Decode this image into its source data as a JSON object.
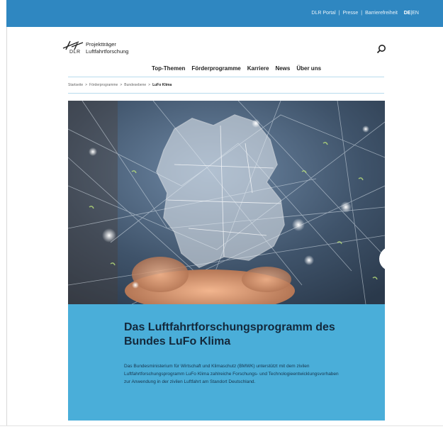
{
  "topbar": {
    "links": [
      "DLR Portal",
      "Presse",
      "Barrierefreiheit"
    ],
    "separator": "|",
    "lang_active": "DE",
    "lang_other": "EN"
  },
  "brand": {
    "line1": "Projektträger",
    "line2": "Luftfahrtforschung",
    "short": "DLR"
  },
  "nav": {
    "items": [
      "Top-Themen",
      "Förderprogramme",
      "Karriere",
      "News",
      "Über uns"
    ]
  },
  "breadcrumb": {
    "items": [
      "Startseite",
      "Förderprogramme",
      "Bundesebene"
    ],
    "current": "LuFo Klima",
    "separator": ">"
  },
  "hero": {
    "image_icon": "germany-map-network-hand-image"
  },
  "panel": {
    "title": "Das Luftfahrtforschungsprogramm des Bundes LuFo Klima",
    "body": "Das Bundesministerium für Wirtschaft und Klimaschutz (BMWK) unterstützt mit dem zivilen Luftfahrtforschungsprogramm LuFo Klima zahlreiche Forschungs- und Technologieentwicklungsvorhaben zur Anwendung in der zivilen Luftfahrt am Standort Deutschland."
  },
  "colors": {
    "topbar": "#2f87c1",
    "panel": "#4aaed9",
    "title": "#13283b"
  }
}
